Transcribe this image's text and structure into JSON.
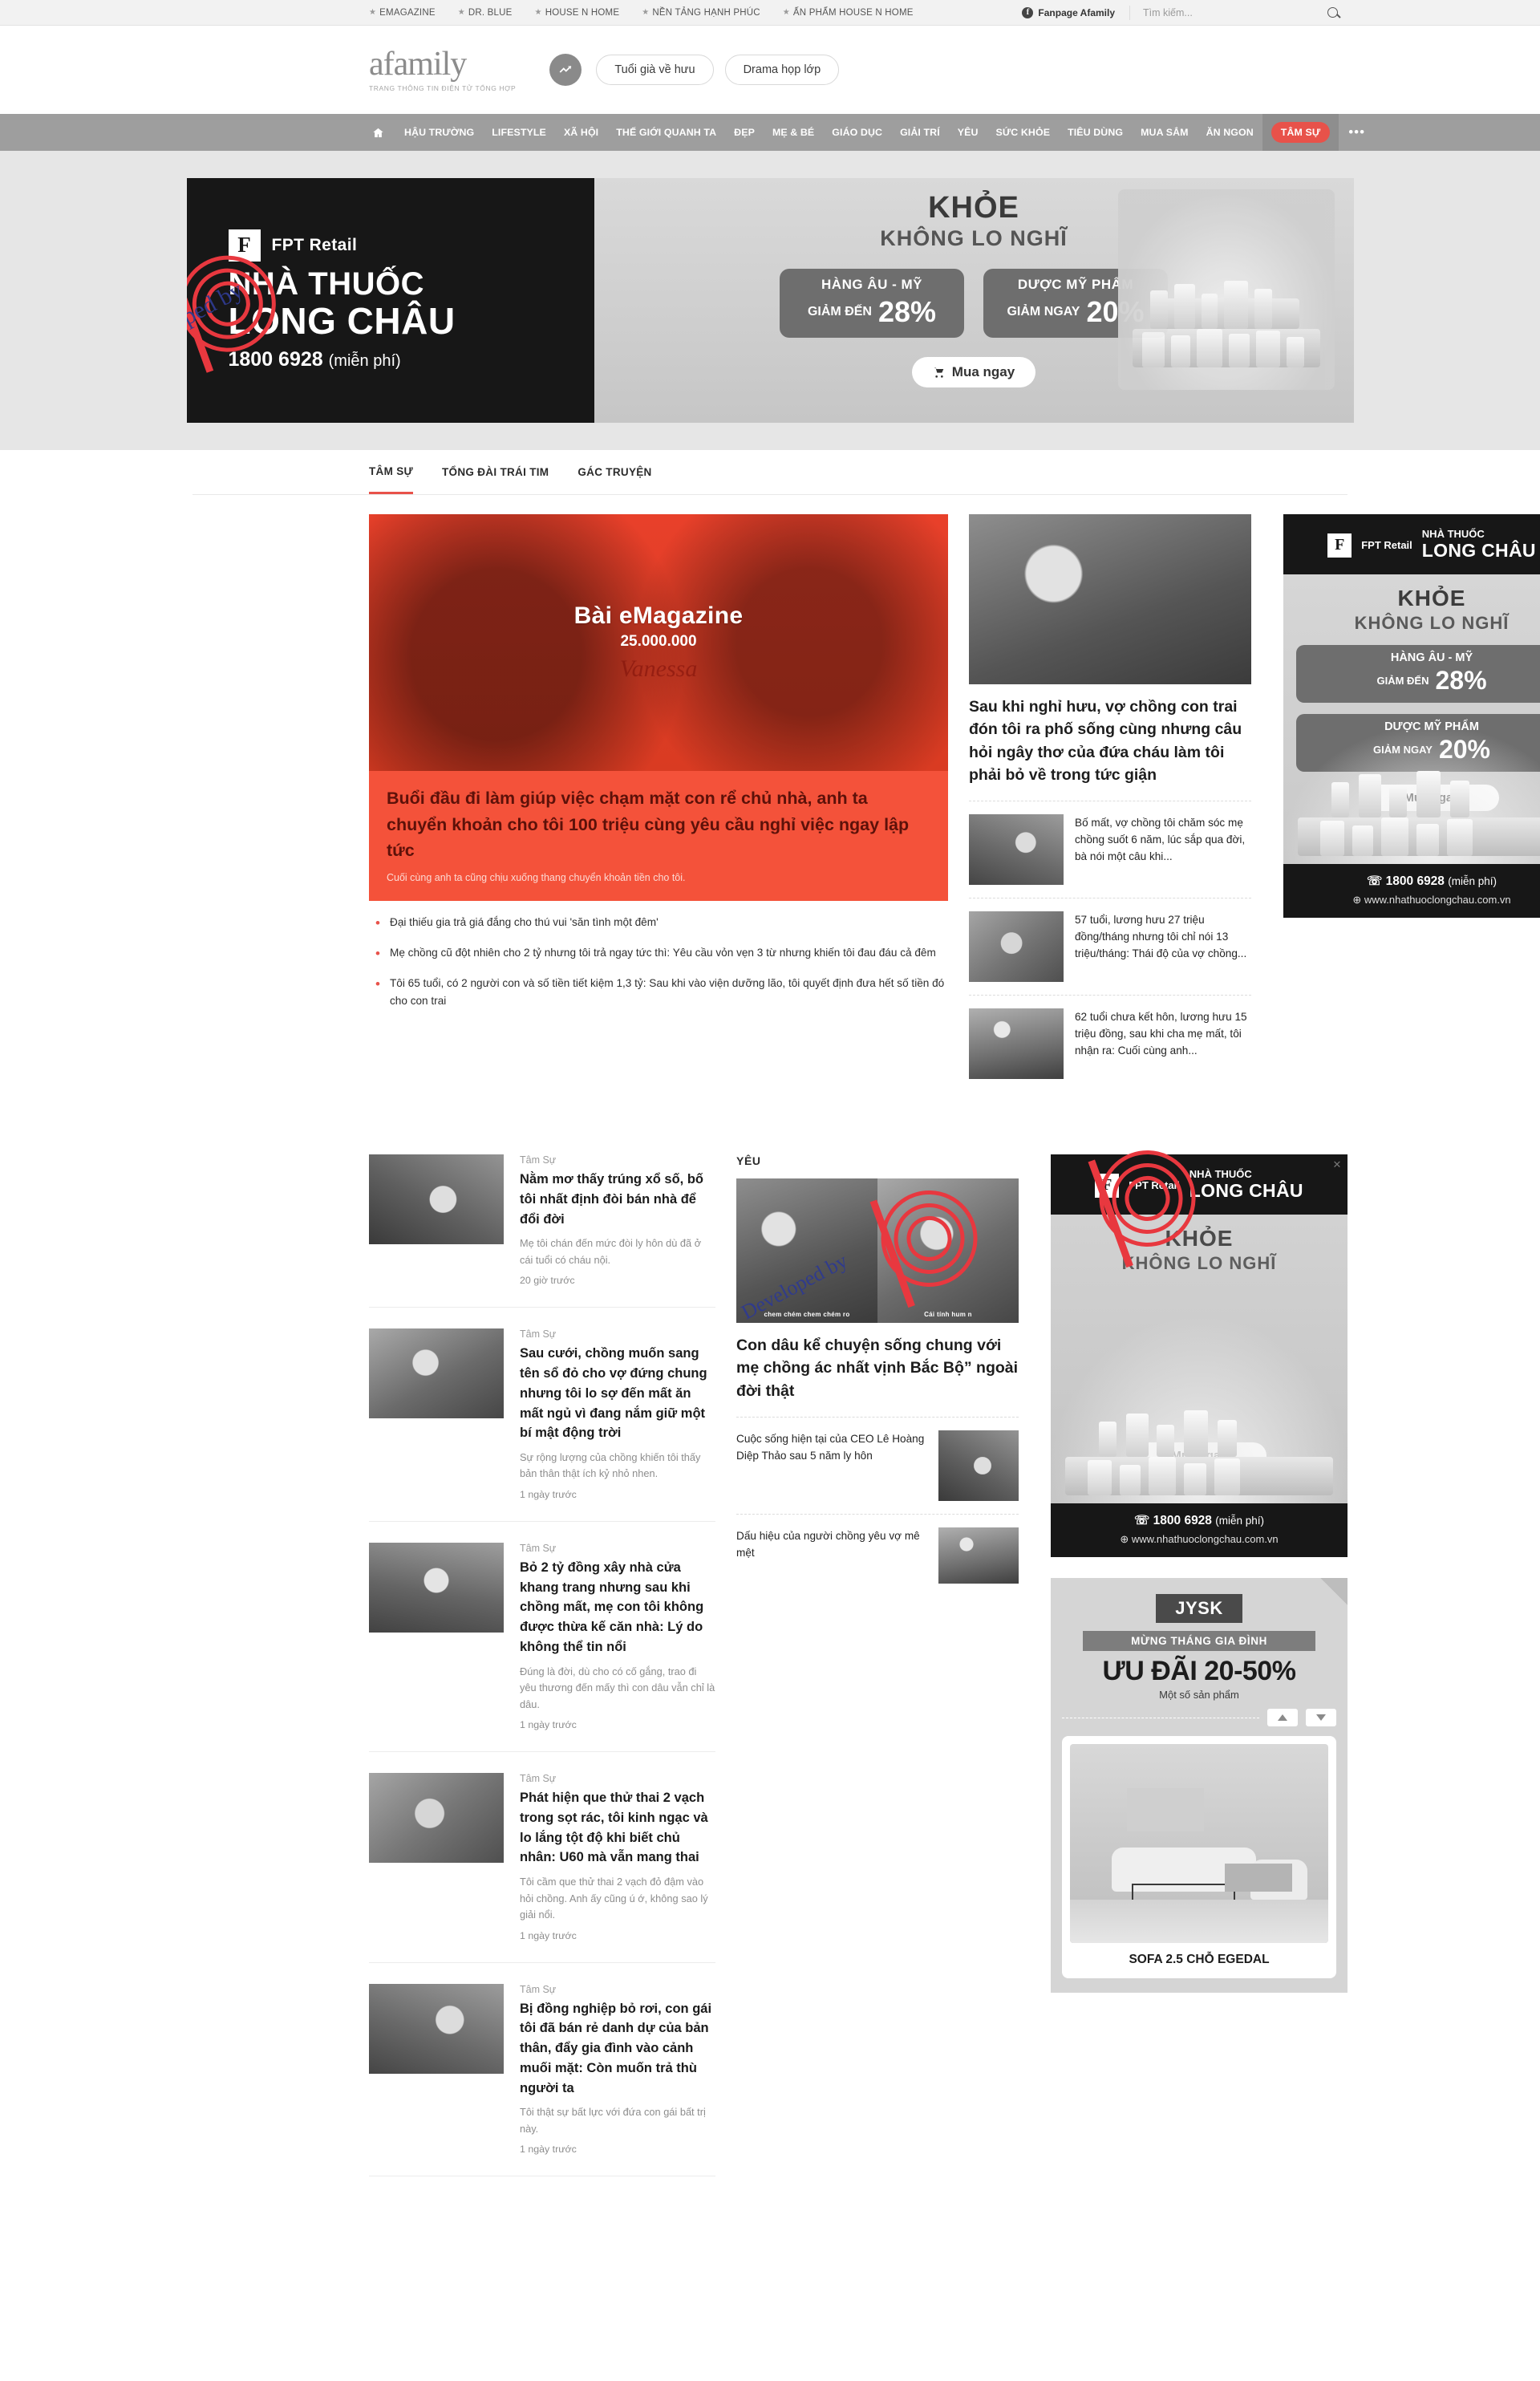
{
  "topbar": {
    "links": [
      {
        "label": "EMAGAZINE",
        "icon": "star-icon"
      },
      {
        "label": "DR. BLUE",
        "icon": "star-icon"
      },
      {
        "label": "HOUSE N HOME",
        "icon": "star-icon"
      },
      {
        "label": "NỀN TẢNG HẠNH PHÚC",
        "icon": "star-icon"
      },
      {
        "label": "ẤN PHẨM HOUSE N HOME",
        "icon": "star-icon"
      }
    ],
    "fanpage_label": "Fanpage Afamily",
    "fanpage_icon": "facebook-icon",
    "search_placeholder": "Tìm kiếm...",
    "search_value": "",
    "search_icon": "search-icon"
  },
  "brand": {
    "name": "afamily",
    "tagline": "TRANG THÔNG TIN ĐIỆN TỬ TỔNG HỢP",
    "trending_icon": "trending-up-icon",
    "chips": [
      "Tuổi già về hưu",
      "Drama họp lớp"
    ]
  },
  "nav": {
    "home_icon": "home-icon",
    "items": [
      {
        "label": "HẬU TRƯỜNG",
        "active": false
      },
      {
        "label": "LIFESTYLE",
        "active": false
      },
      {
        "label": "XÃ HỘI",
        "active": false
      },
      {
        "label": "THẾ GIỚI QUANH TA",
        "active": false
      },
      {
        "label": "ĐẸP",
        "active": false
      },
      {
        "label": "MẸ & BÉ",
        "active": false
      },
      {
        "label": "GIÁO DỤC",
        "active": false
      },
      {
        "label": "GIẢI TRÍ",
        "active": false
      },
      {
        "label": "YÊU",
        "active": false
      },
      {
        "label": "SỨC KHỎE",
        "active": false
      },
      {
        "label": "TIÊU DÙNG",
        "active": false
      },
      {
        "label": "MUA SẮM",
        "active": false
      },
      {
        "label": "ĂN NGON",
        "active": false
      },
      {
        "label": "TÂM SỰ",
        "active": true
      }
    ],
    "more_label": "•••"
  },
  "top_banner": {
    "brand_mark": "F",
    "brand_small": "FPT Retail",
    "line1": "NHÀ THUỐC",
    "line2": "LONG CHÂU",
    "phone": "1800 6928",
    "phone_note": "(miễn phí)",
    "promo_title": "KHỎE",
    "promo_sub": "KHÔNG LO NGHĨ",
    "offers": [
      {
        "label": "HÀNG ÂU - MỸ",
        "prefix": "GIẢM ĐẾN",
        "value": "28%"
      },
      {
        "label": "DƯỢC MỸ PHẨM",
        "prefix": "GIẢM NGAY",
        "value": "20%"
      }
    ],
    "cta": "Mua ngay",
    "cta_icon": "cart-icon"
  },
  "subnav": {
    "items": [
      {
        "label": "TÂM SỰ",
        "active": true
      },
      {
        "label": "TỔNG ĐÀI TRÁI TIM",
        "active": false
      },
      {
        "label": "GÁC TRUYỆN",
        "active": false
      }
    ]
  },
  "hero": {
    "badge_title": "Bài eMagazine",
    "badge_number": "25.000.000",
    "signature": "Vanessa",
    "headline": "Buổi đầu đi làm giúp việc chạm mặt con rể chủ nhà, anh ta chuyển khoản cho tôi 100 triệu cùng yêu cầu nghỉ việc ngay lập tức",
    "sapo": "Cuối cùng anh ta cũng chịu xuống thang chuyển khoản tiền cho tôi.",
    "bullets": [
      "Đại thiếu gia trả giá đắng cho thú vui 'săn tình một đêm'",
      "Mẹ chồng cũ đột nhiên cho 2 tỷ nhưng tôi trả ngay tức thì: Yêu cầu vỏn vẹn 3 từ nhưng khiến tôi đau đáu cả đêm",
      "Tôi 65 tuổi, có 2 người con và số tiền tiết kiệm 1,3 tỷ: Sau khi vào viện dưỡng lão, tôi quyết định đưa hết số tiền đó cho con trai"
    ]
  },
  "mid_column": {
    "lead": {
      "headline": "Sau khi nghỉ hưu, vợ chồng con trai đón tôi ra phố sống cùng nhưng câu hỏi ngây thơ của đứa cháu làm tôi phải bỏ về trong tức giận"
    },
    "items": [
      {
        "headline": "Bố mất, vợ chồng tôi chăm sóc mẹ chồng suốt 6 năm, lúc sắp qua đời, bà nói một câu khi..."
      },
      {
        "headline": "57 tuổi, lương hưu 27 triệu đồng/tháng nhưng tôi chỉ nói 13 triệu/tháng: Thái độ của vợ chồng..."
      },
      {
        "headline": "62 tuổi chưa kết hôn, lương hưu 15 triệu đồng, sau khi cha mẹ mất, tôi nhận ra: Cuối cùng anh..."
      }
    ]
  },
  "yeu_section": {
    "title": "YÊU",
    "lead": {
      "headline": "Con dâu kể chuyện sống chung với mẹ chồng ác nhất vịnh Bắc Bộ” ngoài đời thật",
      "caption_left": "chem chém chem chém ro",
      "caption_right": "Cái tính hum n"
    },
    "items": [
      {
        "headline": "Cuộc sống hiện tại của CEO Lê Hoàng Diệp Thảo sau 5 năm ly hôn"
      },
      {
        "headline": "Dấu hiệu của người chồng yêu vợ mê mệt"
      }
    ]
  },
  "news_list": [
    {
      "category": "Tâm Sự",
      "headline": "Nằm mơ thấy trúng xổ số, bố tôi nhất định đòi bán nhà để đổi đời",
      "sapo": "Mẹ tôi chán đến mức đòi ly hôn dù đã ở cái tuổi có cháu nội.",
      "time": "20 giờ trước"
    },
    {
      "category": "Tâm Sự",
      "headline": "Sau cưới, chồng muốn sang tên sổ đỏ cho vợ đứng chung nhưng tôi lo sợ đến mất ăn mất ngủ vì đang nắm giữ một bí mật động trời",
      "sapo": "Sự rộng lượng của chồng khiến tôi thấy bản thân thật ích kỷ nhỏ nhen.",
      "time": "1 ngày trước"
    },
    {
      "category": "Tâm Sự",
      "headline": "Bỏ 2 tỷ đồng xây nhà cửa khang trang nhưng sau khi chồng mất, mẹ con tôi không được thừa kế căn nhà: Lý do không thể tin nổi",
      "sapo": "Đúng là đời, dù cho có cố gắng, trao đi yêu thương đến mấy thì con dâu vẫn chỉ là dâu.",
      "time": "1 ngày trước"
    },
    {
      "category": "Tâm Sự",
      "headline": "Phát hiện que thử thai 2 vạch trong sọt rác, tôi kinh ngạc và lo lắng tột độ khi biết chủ nhân: U60 mà vẫn mang thai",
      "sapo": "Tôi cầm que thử thai 2 vạch đỏ đậm vào hỏi chồng. Anh ấy cũng ú ớ, không sao lý giải nổi.",
      "time": "1 ngày trước"
    },
    {
      "category": "Tâm Sự",
      "headline": "Bị đồng nghiệp bỏ rơi, con gái tôi đã bán rẻ danh dự của bản thân, đẩy gia đình vào cảnh muối mặt: Còn muốn trả thù người ta",
      "sapo": "Tôi thật sự bất lực với đứa con gái bất trị này.",
      "time": "1 ngày trước"
    }
  ],
  "sidebar_ads": [
    {
      "id": "longchau-1",
      "brand_mark": "F",
      "brand_small": "FPT Retail",
      "name": "NHÀ THUỐC",
      "name2": "LONG CHÂU",
      "promo_title": "KHỎE",
      "promo_sub": "KHÔNG LO NGHĨ",
      "offers": [
        {
          "label": "HÀNG ÂU - MỸ",
          "prefix": "GIẢM ĐẾN",
          "value": "28%"
        },
        {
          "label": "DƯỢC MỸ PHẨM",
          "prefix": "GIẢM NGAY",
          "value": "20%"
        }
      ],
      "cta": "Mua ngay",
      "phone": "1800 6928",
      "phone_note": "(miễn phí)",
      "url": "www.nhathuoclongchau.com.vn",
      "close_icon": "close-icon"
    },
    {
      "id": "longchau-2",
      "brand_mark": "F",
      "brand_small": "FPT Retail",
      "name": "NHÀ THUỐC",
      "name2": "LONG CHÂU",
      "promo_title": "KHỎE",
      "promo_sub": "KHÔNG LO NGHĨ",
      "offers": [],
      "cta": "Mua ngay",
      "phone": "1800 6928",
      "phone_note": "(miễn phí)",
      "url": "www.nhathuoclongchau.com.vn",
      "close_icon": "close-icon"
    }
  ],
  "jysk_ad": {
    "logo": "JYSK",
    "ribbon": "MỪNG THÁNG GIA ĐÌNH",
    "headline": "ƯU ĐÃI 20-50%",
    "sub": "Một số sản phẩm",
    "product_name": "SOFA 2.5 CHỖ EGEDAL",
    "prev_icon": "chevron-up-icon",
    "next_icon": "chevron-down-icon",
    "close_icon": "close-icon"
  },
  "watermark": {
    "text": "Developed by",
    "logo": "Digihub"
  },
  "colors": {
    "accent": "#e8524a",
    "hero_bg": "#f4523a",
    "nav_bg": "#9e9e9e",
    "topbar_bg": "#f2f2f2",
    "dark": "#171717"
  }
}
